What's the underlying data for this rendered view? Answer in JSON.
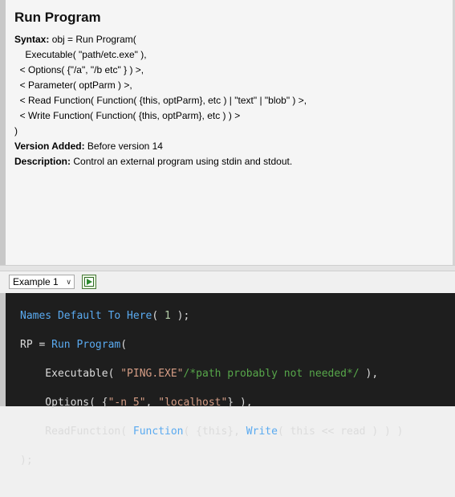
{
  "help": {
    "title": "Run Program",
    "syntax_label": "Syntax:",
    "syntax_lines": [
      " obj = Run Program(",
      "    Executable( \"path/etc.exe\" ),",
      "  < Options( {\"/a\", \"/b etc\" } ) >,",
      "  < Parameter( optParm ) >,",
      "  < Read Function( Function( {this, optParm}, etc ) | \"text\" | \"blob\" ) >,",
      "  < Write Function( Function( {this, optParm}, etc ) ) >",
      ")"
    ],
    "version_label": "Version Added:",
    "version_value": " Before version 14",
    "description_label": "Description:",
    "description_value": " Control an external program using stdin and stdout."
  },
  "toolbar": {
    "example_selected": "Example 1",
    "run_button": "run-script"
  },
  "code": {
    "line1": {
      "a": "Names Default To Here",
      "b": "( ",
      "c": "1",
      "d": " );"
    },
    "line2": {
      "a": "RP = ",
      "b": "Run Program",
      "c": "("
    },
    "line3": {
      "a": "    Executable( ",
      "b": "\"PING.EXE\"",
      "c": "/*path probably not needed*/",
      "d": " ),"
    },
    "line4": {
      "a": "    Options( {",
      "b": "\"-n 5\"",
      "c": ", ",
      "d": "\"localhost\"",
      "e": "} ),"
    },
    "line5": {
      "a": "    ReadFunction( ",
      "b": "Function",
      "c": "( {this}, ",
      "d": "Write",
      "e": "( this << read ) ) )"
    },
    "line6": {
      "a": ");"
    }
  },
  "colors": {
    "code_bg": "#1e1e1e",
    "identifier": "#5aaaf0",
    "string": "#d69d85",
    "comment": "#57a64a",
    "number": "#b5cea8"
  }
}
